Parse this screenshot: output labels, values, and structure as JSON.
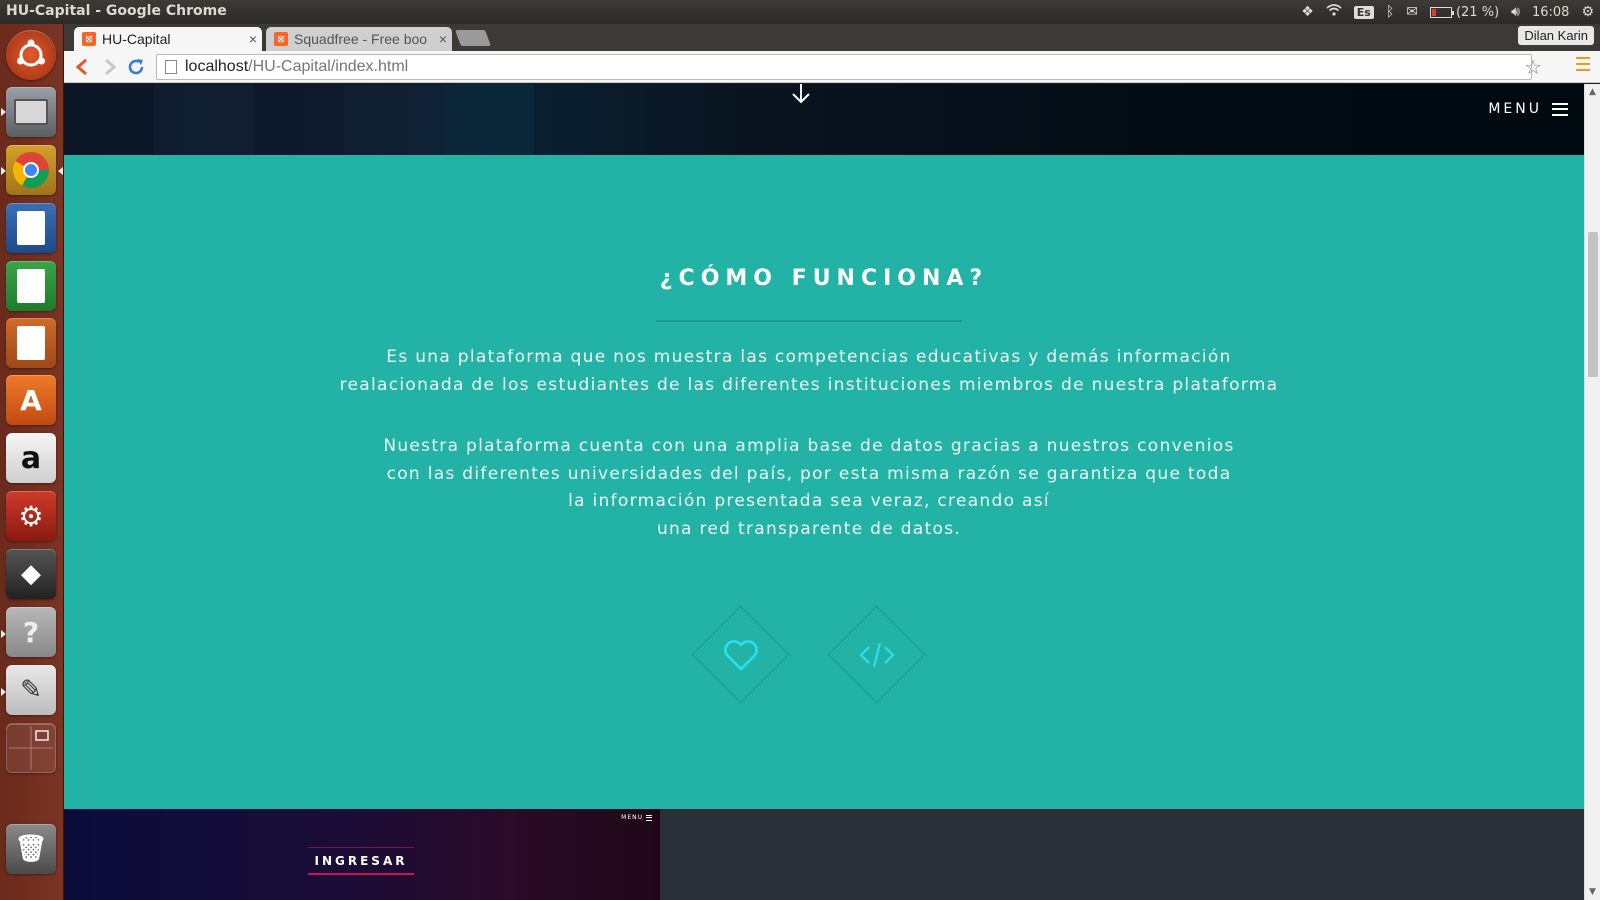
{
  "system_panel": {
    "window_title": "HU-Capital - Google Chrome",
    "keyboard_layout": "Es",
    "battery": "(21 %)",
    "clock": "16:08"
  },
  "launcher": {
    "apps": [
      "ubuntu-dash",
      "files",
      "chrome",
      "writer",
      "calc",
      "impress",
      "software-center",
      "amazon",
      "system-settings",
      "inkscape",
      "help",
      "text-editor",
      "workspaces",
      "trash"
    ]
  },
  "browser": {
    "tabs": [
      {
        "label": "HU-Capital",
        "close": "×"
      },
      {
        "label": "Squadfree - Free boo",
        "close": "×"
      }
    ],
    "user": "Dilan Karin",
    "url_host": "localhost",
    "url_path": "/HU-Capital/index.html"
  },
  "page": {
    "menu_label": "MENU",
    "section_title": "¿CÓMO FUNCIONA?",
    "paragraph1": [
      "Es una plataforma que nos muestra las competencias educativas y demás información",
      "realacionada de los estudiantes de las diferentes instituciones miembros de nuestra plataforma"
    ],
    "paragraph2": [
      "Nuestra plataforma cuenta con una amplia base de datos gracias a nuestros convenios",
      "con las diferentes universidades del país, por esta misma razón se garantiza que toda",
      "la información presentada sea veraz, creando así",
      "una red transparente de datos."
    ],
    "preview": {
      "menu_label": "MENU",
      "button_label": "INGRESAR"
    }
  },
  "colors": {
    "teal": "#22b3a6",
    "diamond_border": "#1c978c",
    "icon_cyan": "#2de0ef",
    "accent_pink": "#c2185b"
  }
}
